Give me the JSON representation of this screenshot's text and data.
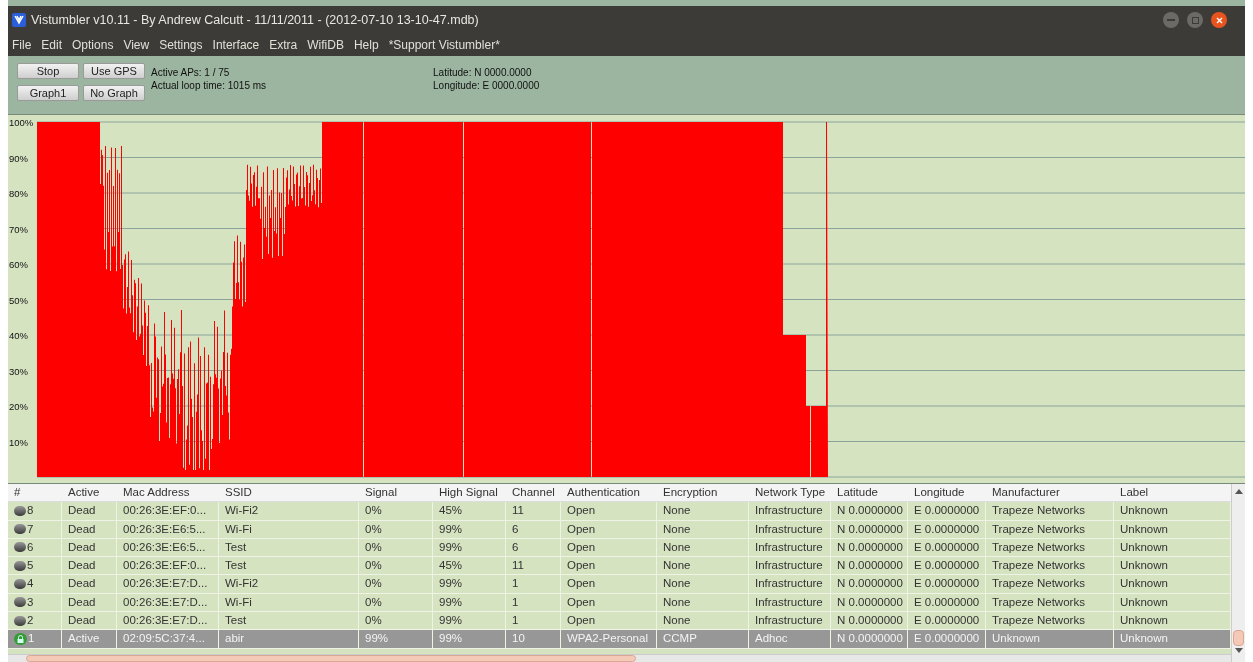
{
  "window": {
    "title": "Vistumbler v10.11 - By Andrew Calcutt - 11/11/2011 - (2012-07-10 13-10-47.mdb)"
  },
  "menu": [
    "File",
    "Edit",
    "Options",
    "View",
    "Settings",
    "Interface",
    "Extra",
    "WifiDB",
    "Help",
    "*Support Vistumbler*"
  ],
  "toolbar": {
    "buttons": [
      [
        "Stop",
        "Use GPS"
      ],
      [
        "Graph1",
        "No Graph"
      ]
    ],
    "status": [
      "Active APs: 1 / 75",
      "Actual loop time: 1015 ms"
    ],
    "gps": [
      "Latitude: N 0000.0000",
      "Longitude: E 0000.0000"
    ]
  },
  "graph": {
    "y_labels": [
      "100%",
      "90%",
      "80%",
      "70%",
      "60%",
      "50%",
      "40%",
      "30%",
      "20%",
      "10%"
    ]
  },
  "table": {
    "columns": [
      "#",
      "Active",
      "Mac Address",
      "SSID",
      "Signal",
      "High Signal",
      "Channel",
      "Authentication",
      "Encryption",
      "Network Type",
      "Latitude",
      "Longitude",
      "Manufacturer",
      "Label"
    ],
    "rows": [
      {
        "kind": "dead",
        "selected": false,
        "cells": [
          "8",
          "Dead",
          "00:26:3E:EF:0...",
          "Wi-Fi2",
          "0%",
          "45%",
          "11",
          "Open",
          "None",
          "Infrastructure",
          "N 0.0000000",
          "E 0.0000000",
          "Trapeze Networks",
          "Unknown"
        ]
      },
      {
        "kind": "dead",
        "selected": false,
        "cells": [
          "7",
          "Dead",
          "00:26:3E:E6:5...",
          "Wi-Fi",
          "0%",
          "99%",
          "6",
          "Open",
          "None",
          "Infrastructure",
          "N 0.0000000",
          "E 0.0000000",
          "Trapeze Networks",
          "Unknown"
        ]
      },
      {
        "kind": "dead",
        "selected": false,
        "cells": [
          "6",
          "Dead",
          "00:26:3E:E6:5...",
          "Test",
          "0%",
          "99%",
          "6",
          "Open",
          "None",
          "Infrastructure",
          "N 0.0000000",
          "E 0.0000000",
          "Trapeze Networks",
          "Unknown"
        ]
      },
      {
        "kind": "dead",
        "selected": false,
        "cells": [
          "5",
          "Dead",
          "00:26:3E:EF:0...",
          "Test",
          "0%",
          "45%",
          "11",
          "Open",
          "None",
          "Infrastructure",
          "N 0.0000000",
          "E 0.0000000",
          "Trapeze Networks",
          "Unknown"
        ]
      },
      {
        "kind": "dead",
        "selected": false,
        "cells": [
          "4",
          "Dead",
          "00:26:3E:E7:D...",
          "Wi-Fi2",
          "0%",
          "99%",
          "1",
          "Open",
          "None",
          "Infrastructure",
          "N 0.0000000",
          "E 0.0000000",
          "Trapeze Networks",
          "Unknown"
        ]
      },
      {
        "kind": "dead",
        "selected": false,
        "cells": [
          "3",
          "Dead",
          "00:26:3E:E7:D...",
          "Wi-Fi",
          "0%",
          "99%",
          "1",
          "Open",
          "None",
          "Infrastructure",
          "N 0.0000000",
          "E 0.0000000",
          "Trapeze Networks",
          "Unknown"
        ]
      },
      {
        "kind": "dead",
        "selected": false,
        "cells": [
          "2",
          "Dead",
          "00:26:3E:E7:D...",
          "Test",
          "0%",
          "99%",
          "1",
          "Open",
          "None",
          "Infrastructure",
          "N 0.0000000",
          "E 0.0000000",
          "Trapeze Networks",
          "Unknown"
        ]
      },
      {
        "kind": "active",
        "selected": true,
        "cells": [
          "1",
          "Active",
          "02:09:5C:37:4...",
          "abir",
          "99%",
          "99%",
          "10",
          "WPA2-Personal",
          "CCMP",
          "Adhoc",
          "N 0.0000000",
          "E 0.0000000",
          "Unknown",
          "Unknown"
        ]
      }
    ]
  }
}
